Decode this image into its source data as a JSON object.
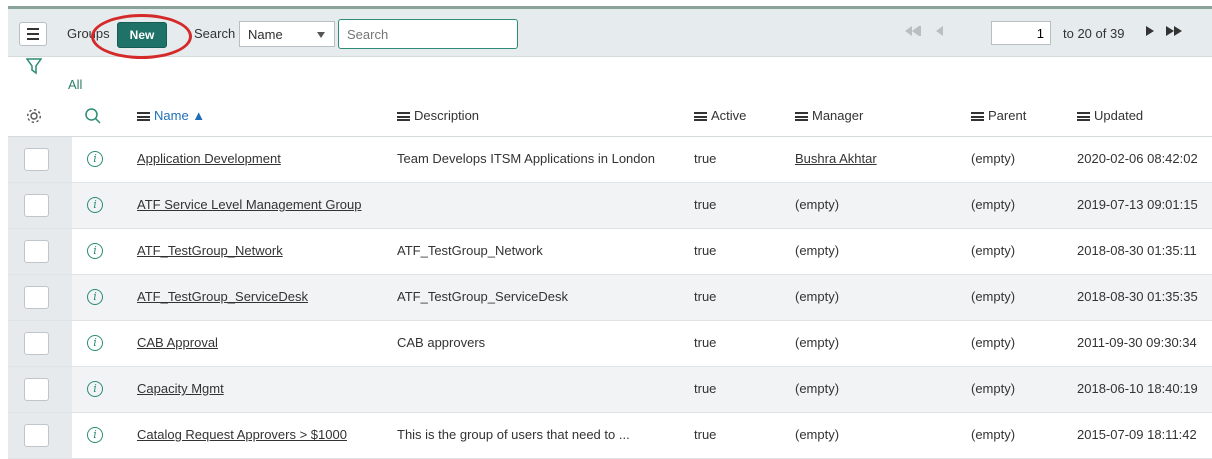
{
  "header": {
    "list_title": "Groups",
    "new_label": "New",
    "search_label": "Search",
    "search_field": "Name",
    "search_placeholder": "Search",
    "page_value": "1",
    "page_range": "to 20 of 39"
  },
  "filter": {
    "breadcrumb": "All"
  },
  "columns": {
    "name": "Name ▲",
    "description": "Description",
    "active": "Active",
    "manager": "Manager",
    "parent": "Parent",
    "updated": "Updated"
  },
  "rows": [
    {
      "name": "Application Development",
      "description": "Team Develops ITSM Applications in London",
      "active": "true",
      "manager": "Bushra Akhtar",
      "parent": "(empty)",
      "updated": "2020-02-06 08:42:02"
    },
    {
      "name": "ATF Service Level Management Group",
      "description": "",
      "active": "true",
      "manager": "(empty)",
      "parent": "(empty)",
      "updated": "2019-07-13 09:01:15"
    },
    {
      "name": "ATF_TestGroup_Network",
      "description": "ATF_TestGroup_Network",
      "active": "true",
      "manager": "(empty)",
      "parent": "(empty)",
      "updated": "2018-08-30 01:35:11"
    },
    {
      "name": "ATF_TestGroup_ServiceDesk",
      "description": "ATF_TestGroup_ServiceDesk",
      "active": "true",
      "manager": "(empty)",
      "parent": "(empty)",
      "updated": "2018-08-30 01:35:35"
    },
    {
      "name": "CAB Approval",
      "description": "CAB approvers",
      "active": "true",
      "manager": "(empty)",
      "parent": "(empty)",
      "updated": "2011-09-30 09:30:34"
    },
    {
      "name": "Capacity Mgmt",
      "description": "",
      "active": "true",
      "manager": "(empty)",
      "parent": "(empty)",
      "updated": "2018-06-10 18:40:19"
    },
    {
      "name": "Catalog Request Approvers > $1000",
      "description": "This is the group of users that need to ...",
      "active": "true",
      "manager": "(empty)",
      "parent": "(empty)",
      "updated": "2015-07-09 18:11:42"
    }
  ],
  "colors": {
    "brand_green": "#1e7267",
    "accent_teal": "#2b8c74",
    "annotation_red": "#d42a2a"
  }
}
